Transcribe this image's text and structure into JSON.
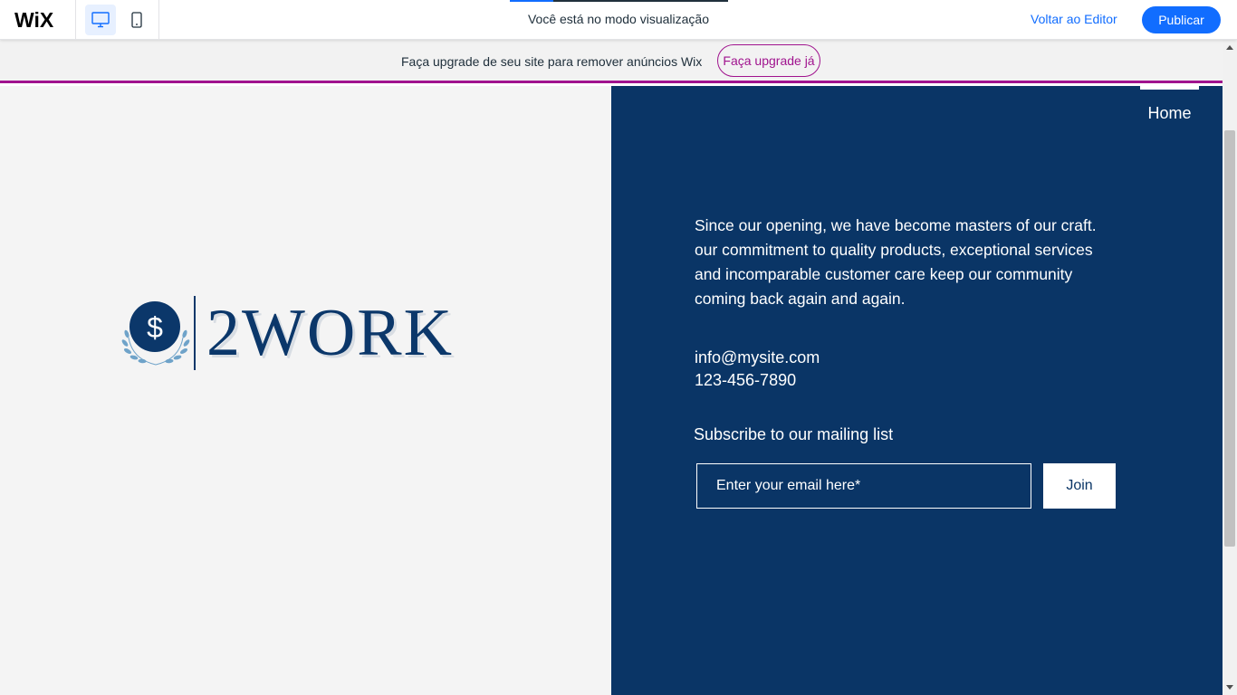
{
  "topbar": {
    "logo": "WiX",
    "devices": [
      {
        "name": "desktop",
        "icon": "desktop-icon",
        "selected": true
      },
      {
        "name": "mobile",
        "icon": "mobile-icon",
        "selected": false
      }
    ],
    "title": "Você está no modo visualização",
    "back_to_editor": "Voltar ao Editor",
    "publish": "Publicar"
  },
  "banner": {
    "text": "Faça upgrade de seu site para remover anúncios Wix",
    "button": "Faça upgrade já"
  },
  "site": {
    "logo": {
      "wordmark": "2WORK",
      "icon": "dollar-laurel-icon",
      "symbol": "$"
    },
    "nav": {
      "home": "Home"
    },
    "about": "Since our opening, we have become masters of our craft. our commitment to quality products, exceptional services and incomparable customer care keep our community coming back again and again.",
    "contact": {
      "email": "info@mysite.com",
      "phone": "123-456-7890"
    },
    "subscribe": {
      "title": "Subscribe to our mailing list",
      "placeholder": "Enter your email here*",
      "button": "Join"
    }
  },
  "colors": {
    "wix_blue": "#116dff",
    "upgrade_purple": "#a0138e",
    "site_navy": "#0a3566",
    "left_bg": "#f4f4f4"
  }
}
